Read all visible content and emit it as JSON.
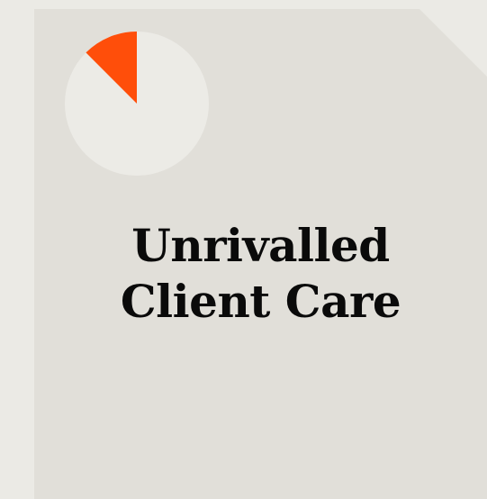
{
  "card": {
    "headline_line1": "Unrivalled",
    "headline_line2": "Client Care"
  },
  "progress_pie": {
    "fraction": 0.125,
    "track_color": "#ecebe6",
    "fill_color": "#ff4e0a"
  },
  "colors": {
    "page_background": "#ebeae5",
    "card_background": "#e1dfd9",
    "text": "#0a0a0a"
  }
}
